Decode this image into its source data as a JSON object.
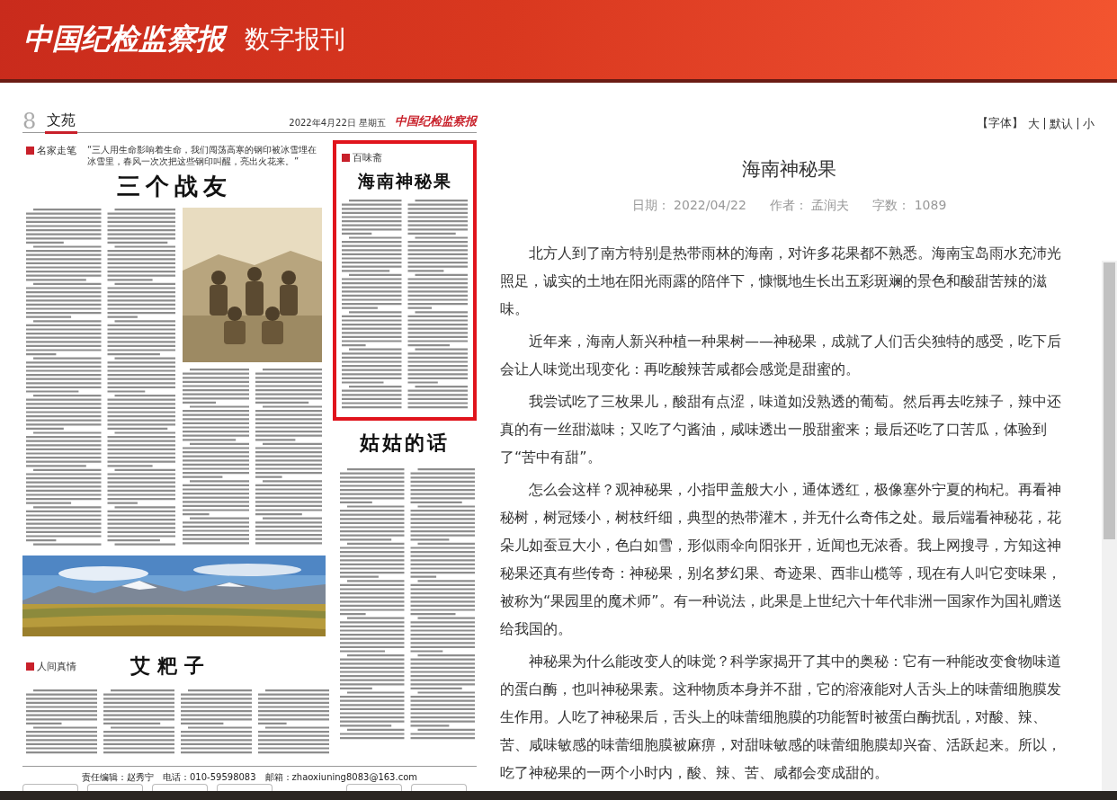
{
  "header": {
    "logo": "中国纪检监察报",
    "subtitle": "数字报刊"
  },
  "newspaper_page": {
    "page_number": "8",
    "section": "文苑",
    "date": "2022年4月22日 星期五",
    "masthead": "中国纪检监察报",
    "articles": [
      {
        "column": "名家走笔",
        "quote": "“三人用生命影响着生命，我们闯荡高寒的钢印被冰雪埋在冰雪里，春风一次次把这些钢印叫醒，亮出火花来。”",
        "title": "三个战友",
        "selected": false
      },
      {
        "column": "百味斋",
        "title": "海南神秘果",
        "selected": true
      },
      {
        "title": "姑姑的话",
        "selected": false
      },
      {
        "column": "人间真情",
        "title": "艾粑子",
        "selected": false
      }
    ],
    "footer": "责任编辑：赵秀宁　电话：010-59598083　邮箱：zhaoxiuning8083@163.com"
  },
  "font_size": {
    "label": "【字体】",
    "options": [
      {
        "label": "大"
      },
      {
        "label": "默认"
      },
      {
        "label": "小"
      }
    ]
  },
  "article": {
    "title": "海南神秘果",
    "meta": [
      {
        "label": "日期：",
        "value": "2022/04/22"
      },
      {
        "label": "作者：",
        "value": "孟润夫"
      },
      {
        "label": "字数：",
        "value": "1089"
      }
    ],
    "paragraphs": [
      "北方人到了南方特别是热带雨林的海南，对许多花果都不熟悉。海南宝岛雨水充沛光照足，诚实的土地在阳光雨露的陪伴下，慷慨地生长出五彩斑斓的景色和酸甜苦辣的滋味。",
      "近年来，海南人新兴种植一种果树——神秘果，成就了人们舌尖独特的感受，吃下后会让人味觉出现变化：再吃酸辣苦咸都会感觉是甜蜜的。",
      "我尝试吃了三枚果儿，酸甜有点涩，味道如没熟透的葡萄。然后再去吃辣子，辣中还真的有一丝甜滋味；又吃了勺酱油，咸味透出一股甜蜜来；最后还吃了口苦瓜，体验到了“苦中有甜”。",
      "怎么会这样？观神秘果，小指甲盖般大小，通体透红，极像塞外宁夏的枸杞。再看神秘树，树冠矮小，树枝纤细，典型的热带灌木，并无什么奇伟之处。最后端看神秘花，花朵儿如蚕豆大小，色白如雪，形似雨伞向阳张开，近闻也无浓香。我上网搜寻，方知这神秘果还真有些传奇：神秘果，别名梦幻果、奇迹果、西非山榄等，现在有人叫它变味果，被称为“果园里的魔术师”。有一种说法，此果是上世纪六十年代非洲一国家作为国礼赠送给我国的。",
      "神秘果为什么能改变人的味觉？科学家揭开了其中的奥秘：它有一种能改变食物味道的蛋白酶，也叫神秘果素。这种物质本身并不甜，它的溶液能对人舌头上的味蕾细胞膜发生作用。人吃了神秘果后，舌头上的味蕾细胞膜的功能暂时被蛋白酶扰乱，对酸、辣、苦、咸味敏感的味蕾细胞膜被麻痹，对甜味敏感的味蕾细胞膜却兴奋、活跃起来。所以，吃了神秘果的一两个小时内，酸、辣、苦、咸都会变成甜的。"
    ]
  }
}
